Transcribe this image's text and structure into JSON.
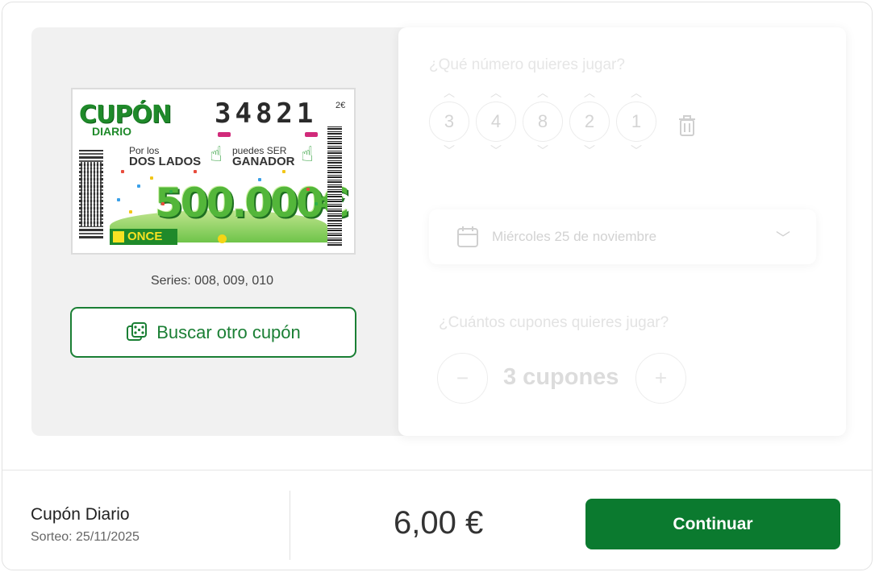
{
  "ticket": {
    "logo_top": "CUPÓN",
    "logo_bottom": "DIARIO",
    "number": "34821",
    "price": "2€",
    "slogan_left_small": "Por los",
    "slogan_left_big": "DOS LADOS",
    "slogan_right_small": "puedes SER",
    "slogan_right_big": "GANADOR",
    "prize": "500.000€",
    "brand": "ONCE"
  },
  "series_text": "Series: 008, 009, 010",
  "search_button_label": "Buscar otro cupón",
  "form": {
    "number_question": "¿Qué número quieres jugar?",
    "digits": [
      "3",
      "4",
      "8",
      "2",
      "1"
    ],
    "date_value": "Miércoles 25 de noviembre",
    "quantity_question": "¿Cuántos cupones quieres jugar?",
    "minus_label": "−",
    "plus_label": "+",
    "quantity_value": "3 cupones"
  },
  "footer": {
    "product_name": "Cupón Diario",
    "draw_date": "Sorteo: 25/11/2025",
    "total_price": "6,00 €",
    "continue_label": "Continuar"
  },
  "colors": {
    "brand_green": "#0b7a2f",
    "outline_green": "#1a7f34",
    "panel_gray": "#f1f1f1"
  },
  "icons": [
    "dice-icon",
    "trash-icon",
    "calendar-icon",
    "chevron-up-icon",
    "chevron-down-icon"
  ]
}
